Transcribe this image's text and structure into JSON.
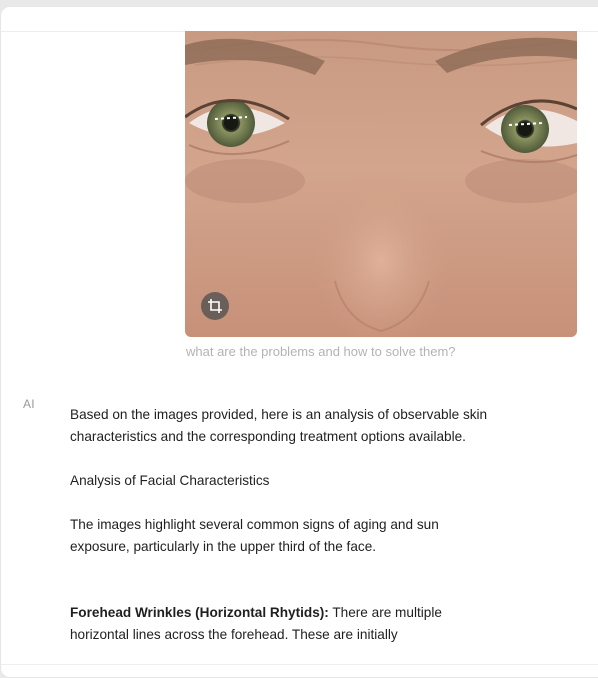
{
  "message": {
    "image_alt": "Close-up photo of a person's eyes, forehead and nose",
    "crop_icon": "crop-icon",
    "caption": "what are the problems and how to solve them?"
  },
  "assistant": {
    "label": "AI",
    "paragraphs": [
      "Based on the images provided, here is an analysis of observable skin characteristics and the corresponding treatment options available.",
      "Analysis of Facial Characteristics",
      "The images highlight several common signs of aging and sun exposure, particularly in the upper third of the face."
    ],
    "item": {
      "title": "Forehead Wrinkles (Horizontal Rhytids):",
      "text": " There are multiple horizontal lines across the forehead. These are initially"
    }
  }
}
